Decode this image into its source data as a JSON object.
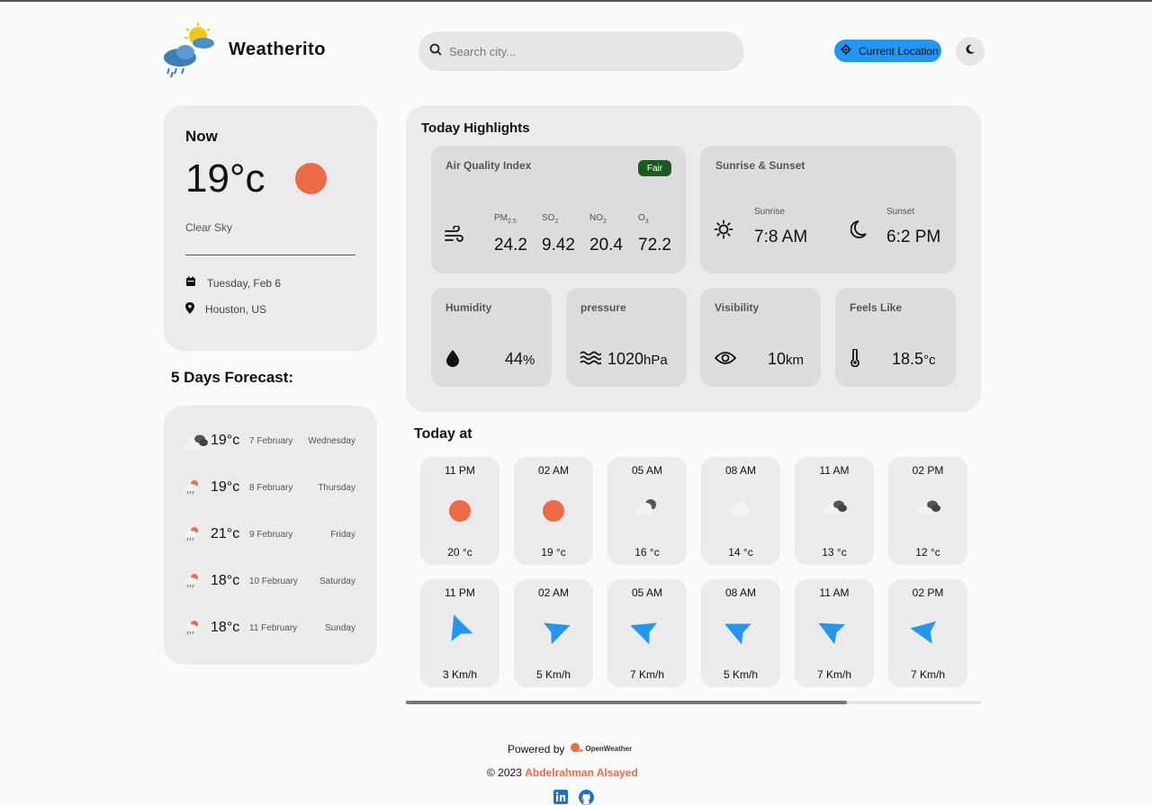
{
  "header": {
    "app_title": "Weatherito",
    "search_placeholder": "Search city...",
    "location_button": "Current Location",
    "logo_icon": "weather-logo-icon",
    "theme_icon": "moon-icon"
  },
  "now": {
    "title": "Now",
    "temp": "19°c",
    "description": "Clear Sky",
    "date": "Tuesday, Feb 6",
    "location": "Houston, US"
  },
  "forecast": {
    "title": "5 Days Forecast:",
    "days": [
      {
        "temp": "19°c",
        "date": "7 February",
        "weekday": "Wednesday",
        "icon": "broken-clouds-icon"
      },
      {
        "temp": "19°c",
        "date": "8 February",
        "weekday": "Thursday",
        "icon": "rain-sun-icon"
      },
      {
        "temp": "21°c",
        "date": "9 February",
        "weekday": "Friday",
        "icon": "rain-sun-icon"
      },
      {
        "temp": "18°c",
        "date": "10 February",
        "weekday": "Saturday",
        "icon": "rain-sun-icon"
      },
      {
        "temp": "18°c",
        "date": "11 February",
        "weekday": "Sunday",
        "icon": "rain-sun-icon"
      }
    ]
  },
  "highlights": {
    "title": "Today Highlights",
    "aqi": {
      "label": "Air Quality Index",
      "badge": "Fair",
      "items": [
        {
          "key": "PM",
          "sub": "2.5",
          "value": "24.2"
        },
        {
          "key": "SO",
          "sub": "2",
          "value": "9.42"
        },
        {
          "key": "NO",
          "sub": "2",
          "value": "20.4"
        },
        {
          "key": "O",
          "sub": "3",
          "value": "72.2"
        }
      ]
    },
    "sun": {
      "label": "Sunrise & Sunset",
      "sunrise_label": "Sunrise",
      "sunrise": "7:8 AM",
      "sunset_label": "Sunset",
      "sunset": "6:2 PM"
    },
    "humidity": {
      "label": "Humidity",
      "value": "44",
      "unit": "%"
    },
    "pressure": {
      "label": "pressure",
      "value": "1020",
      "unit": "hPa"
    },
    "visibility": {
      "label": "Visibility",
      "value": "10",
      "unit": "km"
    },
    "feels_like": {
      "label": "Feels Like",
      "value": "18.5",
      "unit": "°c"
    }
  },
  "today": {
    "title": "Today at",
    "temps": [
      {
        "time": "11 PM",
        "value": "20 °c",
        "icon": "clear-sky-icon"
      },
      {
        "time": "02 AM",
        "value": "19 °c",
        "icon": "clear-sky-icon"
      },
      {
        "time": "05 AM",
        "value": "16 °c",
        "icon": "few-clouds-icon"
      },
      {
        "time": "08 AM",
        "value": "14 °c",
        "icon": "clouds-icon"
      },
      {
        "time": "11 AM",
        "value": "13 °c",
        "icon": "broken-clouds-icon"
      },
      {
        "time": "02 PM",
        "value": "12 °c",
        "icon": "broken-clouds-icon"
      }
    ],
    "winds": [
      {
        "time": "11 PM",
        "value": "3 Km/h",
        "direction_deg": 160
      },
      {
        "time": "02 AM",
        "value": "5 Km/h",
        "direction_deg": 250
      },
      {
        "time": "05 AM",
        "value": "7 Km/h",
        "direction_deg": 110
      },
      {
        "time": "08 AM",
        "value": "5 Km/h",
        "direction_deg": 115
      },
      {
        "time": "11 AM",
        "value": "7 Km/h",
        "direction_deg": 118
      },
      {
        "time": "02 PM",
        "value": "7 Km/h",
        "direction_deg": 100
      }
    ]
  },
  "footer": {
    "powered_by": "Powered by",
    "provider": "OpenWeather",
    "copyright": "© 2023",
    "author": "Abdelrahman Alsayed"
  },
  "colors": {
    "accent": "#2196f3",
    "sun": "#ee6a47",
    "badge": "#1a5c1f"
  }
}
